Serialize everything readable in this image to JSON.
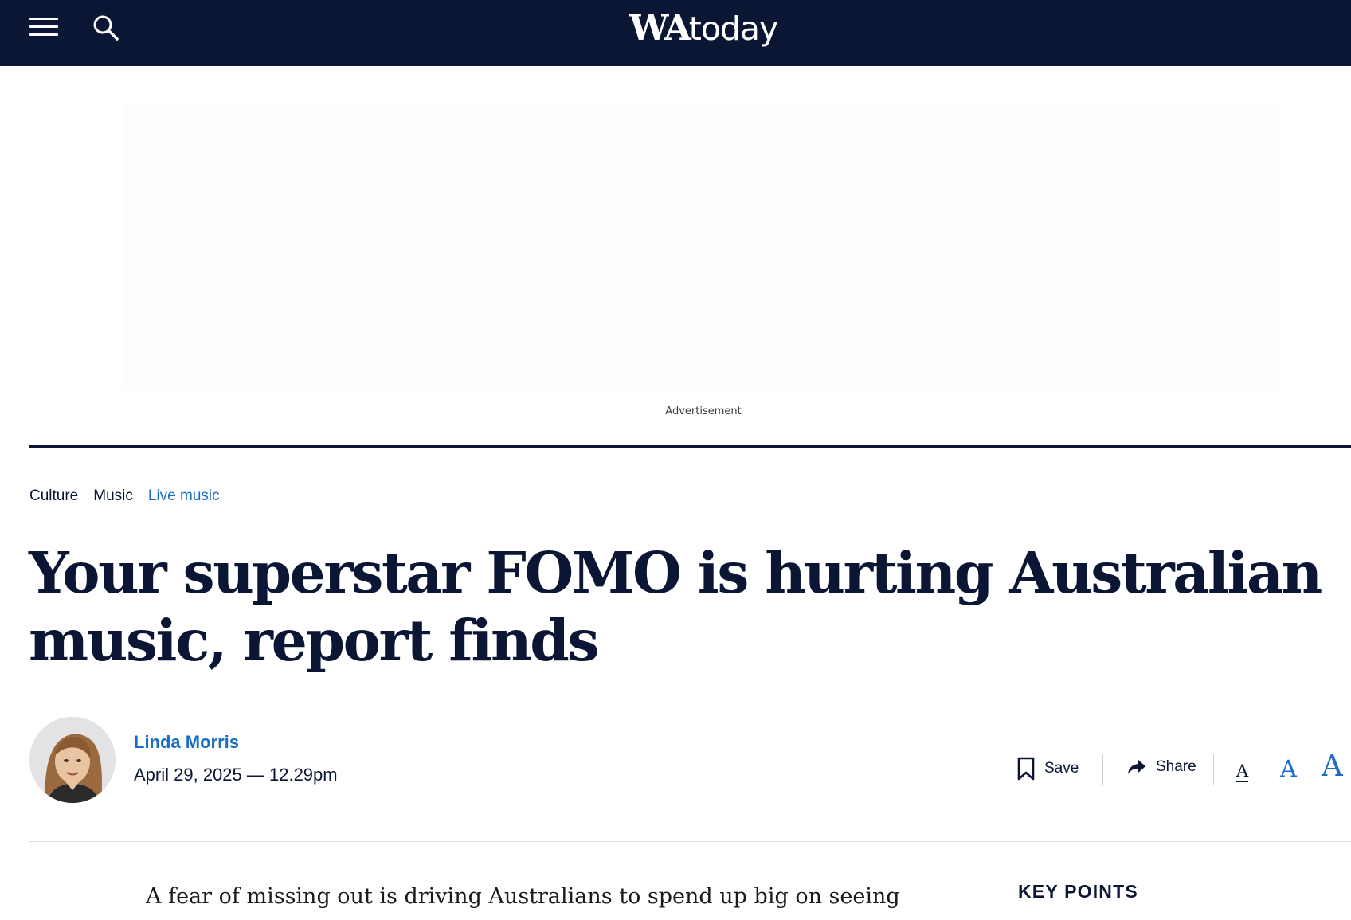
{
  "header": {
    "logo": {
      "primary": "WA",
      "secondary": "today"
    },
    "menu_icon": "menu-icon",
    "search_icon": "search-icon",
    "background": "#0a1633"
  },
  "advertisement": {
    "label": "Advertisement"
  },
  "breadcrumb": [
    {
      "label": "Culture"
    },
    {
      "label": "Music"
    },
    {
      "label": "Live music"
    }
  ],
  "article": {
    "headline": "Your superstar FOMO is hurting Australian music, report finds",
    "author": "Linda Morris",
    "date": "April 29, 2025 — 12.29pm",
    "lead": "A fear of missing out is driving Australians to spend up big on seeing"
  },
  "toolbar": {
    "save_label": "Save",
    "share_label": "Share",
    "font_size_options": [
      "A",
      "A",
      "A"
    ]
  },
  "sidebar": {
    "key_points_title": "KEY POINTS"
  },
  "colors": {
    "navy": "#0a1633",
    "link_blue": "#1a6fc4"
  }
}
